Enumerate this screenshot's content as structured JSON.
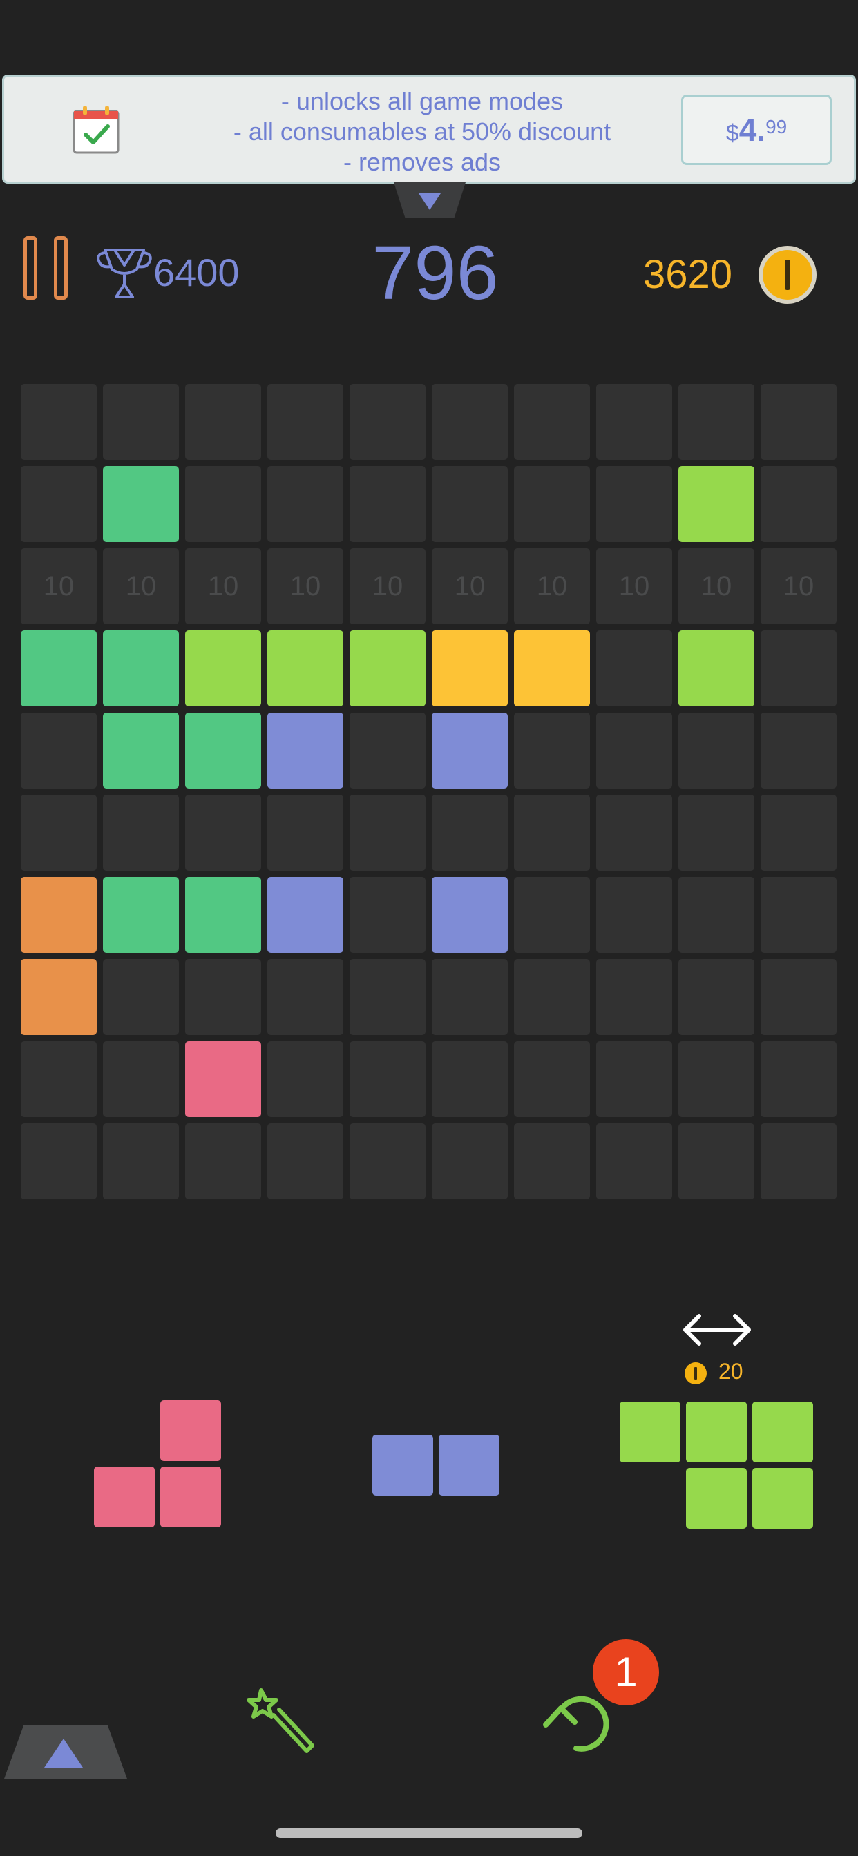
{
  "colors": {
    "background": "#222222",
    "cell_empty": "#323232",
    "accent_blue": "#7b89d6",
    "coin_gold": "#f7b52a",
    "pause_orange": "#e1894d",
    "green": "#52c883",
    "lime": "#96d94c",
    "yellow": "#fdc336",
    "blue": "#7f8cd6",
    "orange": "#e8914a",
    "pink": "#e96a85",
    "badge_red": "#e9431e"
  },
  "banner": {
    "icon": "calendar-check-icon",
    "lines": [
      "- unlocks all game modes",
      "- all consumables at 50% discount",
      "- removes ads"
    ],
    "price_currency": "$",
    "price_whole": "4.",
    "price_cents": "99"
  },
  "header": {
    "best_score": "6400",
    "score": "796",
    "coins": "3620"
  },
  "board": {
    "size": 10,
    "row_marker": "10",
    "rows": [
      [
        "",
        "",
        "",
        "",
        "",
        "",
        "",
        "",
        "",
        ""
      ],
      [
        "",
        "green",
        "",
        "",
        "",
        "",
        "",
        "",
        "lime",
        ""
      ],
      [
        "label",
        "label",
        "label",
        "label",
        "label",
        "label",
        "label",
        "label",
        "label",
        "label"
      ],
      [
        "green",
        "green",
        "lime",
        "lime",
        "lime",
        "yellow",
        "yellow",
        "",
        "lime",
        ""
      ],
      [
        "",
        "green",
        "green",
        "blue",
        "",
        "blue",
        "",
        "",
        "",
        ""
      ],
      [
        "",
        "",
        "",
        "",
        "",
        "",
        "",
        "",
        "",
        ""
      ],
      [
        "orange",
        "green",
        "green",
        "blue",
        "",
        "blue",
        "",
        "",
        "",
        ""
      ],
      [
        "orange",
        "",
        "",
        "",
        "",
        "",
        "",
        "",
        "",
        ""
      ],
      [
        "",
        "",
        "pink",
        "",
        "",
        "",
        "",
        "",
        "",
        ""
      ],
      [
        "",
        "",
        "",
        "",
        "",
        "",
        "",
        "",
        "",
        ""
      ]
    ]
  },
  "pieces": [
    {
      "name": "pink-corner-piece",
      "color": "pink",
      "cells": [
        [
          0,
          1
        ],
        [
          1,
          0
        ],
        [
          1,
          1
        ]
      ]
    },
    {
      "name": "blue-domino-piece",
      "color": "blue",
      "cells": [
        [
          0,
          0
        ],
        [
          0,
          1
        ]
      ]
    },
    {
      "name": "lime-p-piece",
      "color": "lime",
      "cells": [
        [
          0,
          0
        ],
        [
          0,
          1
        ],
        [
          0,
          2
        ],
        [
          1,
          1
        ],
        [
          1,
          2
        ]
      ]
    }
  ],
  "rotate": {
    "icon": "double-arrow-icon",
    "cost": "20"
  },
  "controls": {
    "wand_icon": "magic-wand-icon",
    "undo_icon": "undo-icon",
    "undo_count": "1"
  }
}
